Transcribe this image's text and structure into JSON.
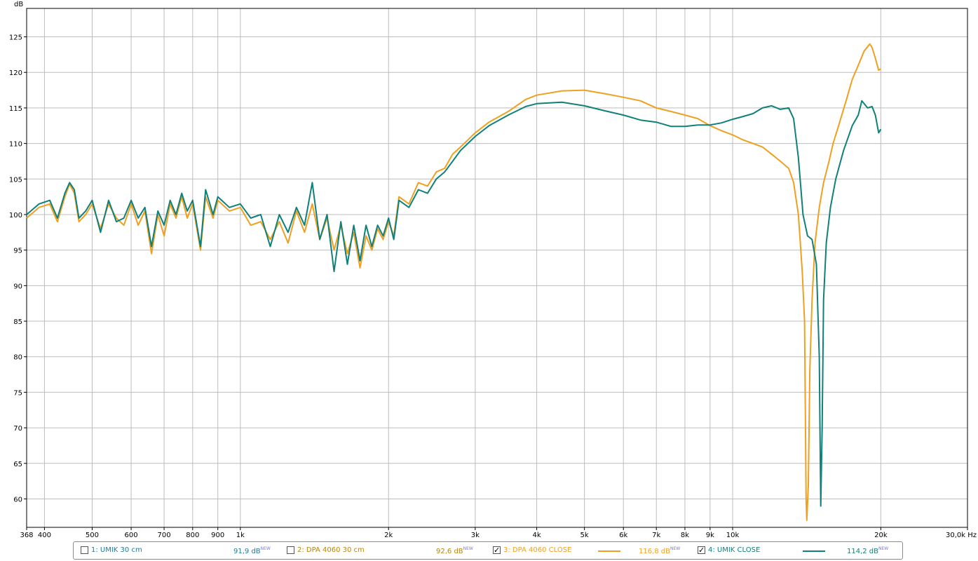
{
  "colors": {
    "grid": "#bdbdbd",
    "axis": "#000000",
    "series3": "#f0a020",
    "series4": "#10807a",
    "series1_text": "#1f7a9a",
    "series2_text": "#b8860b"
  },
  "legend": {
    "entries": [
      {
        "label": "1: UMIK 30 cm",
        "value": "91,9 dB",
        "badge": "NEW",
        "checked": false,
        "checkmark": ""
      },
      {
        "label": "2: DPA 4060 30 cm",
        "value": "92,6 dB",
        "badge": "NEW",
        "checked": false,
        "checkmark": ""
      },
      {
        "label": "3: DPA 4060  CLOSE",
        "value": "116,8 dB",
        "badge": "NEW",
        "checked": true,
        "checkmark": "✓"
      },
      {
        "label": "4: UMIK CLOSE",
        "value": "114,2 dB",
        "badge": "NEW",
        "checked": true,
        "checkmark": "✓"
      }
    ]
  },
  "chart_data": {
    "type": "line",
    "ylabel": "dB",
    "xunit": "Hz",
    "xscale": "log",
    "xlim": [
      368,
      30000
    ],
    "ylim": [
      56,
      129
    ],
    "grid": true,
    "legend_position": "bottom",
    "x_ticks": [
      {
        "v": 368,
        "t": "368"
      },
      {
        "v": 400,
        "t": "400"
      },
      {
        "v": 500,
        "t": "500"
      },
      {
        "v": 600,
        "t": "600"
      },
      {
        "v": 700,
        "t": "700"
      },
      {
        "v": 800,
        "t": "800"
      },
      {
        "v": 900,
        "t": "900"
      },
      {
        "v": 1000,
        "t": "1k"
      },
      {
        "v": 2000,
        "t": "2k"
      },
      {
        "v": 3000,
        "t": "3k"
      },
      {
        "v": 4000,
        "t": "4k"
      },
      {
        "v": 5000,
        "t": "5k"
      },
      {
        "v": 6000,
        "t": "6k"
      },
      {
        "v": 7000,
        "t": "7k"
      },
      {
        "v": 8000,
        "t": "8k"
      },
      {
        "v": 9000,
        "t": "9k"
      },
      {
        "v": 10000,
        "t": "10k"
      },
      {
        "v": 20000,
        "t": "20k"
      },
      {
        "v": 30000,
        "t": "30,0k Hz"
      }
    ],
    "y_ticks": [
      60,
      65,
      70,
      75,
      80,
      85,
      90,
      95,
      100,
      105,
      110,
      115,
      120,
      125
    ],
    "series": [
      {
        "name": "3: DPA 4060  CLOSE",
        "points": [
          [
            368,
            99.5
          ],
          [
            390,
            101.0
          ],
          [
            410,
            101.5
          ],
          [
            425,
            99.0
          ],
          [
            440,
            102.5
          ],
          [
            450,
            104.3
          ],
          [
            460,
            103.0
          ],
          [
            470,
            99.0
          ],
          [
            485,
            100.0
          ],
          [
            500,
            101.5
          ],
          [
            520,
            98.0
          ],
          [
            540,
            101.5
          ],
          [
            560,
            99.5
          ],
          [
            580,
            98.5
          ],
          [
            600,
            101.5
          ],
          [
            620,
            98.5
          ],
          [
            640,
            100.5
          ],
          [
            660,
            94.5
          ],
          [
            680,
            100.0
          ],
          [
            700,
            97.0
          ],
          [
            720,
            101.5
          ],
          [
            740,
            99.5
          ],
          [
            760,
            102.5
          ],
          [
            780,
            99.5
          ],
          [
            800,
            101.5
          ],
          [
            830,
            95.0
          ],
          [
            850,
            102.5
          ],
          [
            880,
            99.5
          ],
          [
            900,
            102.0
          ],
          [
            950,
            100.5
          ],
          [
            1000,
            101.0
          ],
          [
            1050,
            98.5
          ],
          [
            1100,
            99.0
          ],
          [
            1150,
            96.5
          ],
          [
            1200,
            99.0
          ],
          [
            1250,
            96.0
          ],
          [
            1300,
            100.5
          ],
          [
            1350,
            97.5
          ],
          [
            1400,
            101.5
          ],
          [
            1450,
            96.5
          ],
          [
            1500,
            99.5
          ],
          [
            1550,
            95.0
          ],
          [
            1600,
            98.5
          ],
          [
            1650,
            94.5
          ],
          [
            1700,
            97.5
          ],
          [
            1750,
            92.5
          ],
          [
            1800,
            97.0
          ],
          [
            1850,
            95.0
          ],
          [
            1900,
            98.0
          ],
          [
            1950,
            96.5
          ],
          [
            2000,
            99.0
          ],
          [
            2050,
            97.0
          ],
          [
            2100,
            102.5
          ],
          [
            2200,
            101.5
          ],
          [
            2300,
            104.5
          ],
          [
            2400,
            104.0
          ],
          [
            2500,
            106.0
          ],
          [
            2600,
            106.5
          ],
          [
            2700,
            108.5
          ],
          [
            2800,
            109.5
          ],
          [
            3000,
            111.5
          ],
          [
            3200,
            113.0
          ],
          [
            3500,
            114.5
          ],
          [
            3800,
            116.2
          ],
          [
            4000,
            116.8
          ],
          [
            4500,
            117.4
          ],
          [
            5000,
            117.5
          ],
          [
            5500,
            117.0
          ],
          [
            6000,
            116.5
          ],
          [
            6500,
            116.0
          ],
          [
            7000,
            115.0
          ],
          [
            7500,
            114.5
          ],
          [
            8000,
            114.0
          ],
          [
            8500,
            113.5
          ],
          [
            9000,
            112.5
          ],
          [
            9500,
            111.8
          ],
          [
            10000,
            111.2
          ],
          [
            10500,
            110.5
          ],
          [
            11000,
            110.0
          ],
          [
            11500,
            109.5
          ],
          [
            12000,
            108.5
          ],
          [
            12500,
            107.5
          ],
          [
            13000,
            106.5
          ],
          [
            13300,
            104.5
          ],
          [
            13600,
            100.0
          ],
          [
            13850,
            92.0
          ],
          [
            14000,
            85.0
          ],
          [
            14100,
            60.0
          ],
          [
            14150,
            57.0
          ],
          [
            14250,
            62.0
          ],
          [
            14350,
            78.0
          ],
          [
            14500,
            88.0
          ],
          [
            14700,
            96.0
          ],
          [
            15000,
            101.0
          ],
          [
            15300,
            104.5
          ],
          [
            15700,
            107.5
          ],
          [
            16000,
            110.0
          ],
          [
            16500,
            113.0
          ],
          [
            17000,
            116.0
          ],
          [
            17500,
            119.0
          ],
          [
            18000,
            121.0
          ],
          [
            18500,
            123.0
          ],
          [
            19000,
            124.0
          ],
          [
            19200,
            123.5
          ],
          [
            19500,
            122.0
          ],
          [
            19800,
            120.3
          ],
          [
            20000,
            120.5
          ]
        ]
      },
      {
        "name": "4: UMIK CLOSE",
        "points": [
          [
            368,
            100.0
          ],
          [
            390,
            101.5
          ],
          [
            410,
            102.0
          ],
          [
            425,
            99.5
          ],
          [
            440,
            103.0
          ],
          [
            450,
            104.5
          ],
          [
            460,
            103.5
          ],
          [
            470,
            99.5
          ],
          [
            485,
            100.5
          ],
          [
            500,
            102.0
          ],
          [
            520,
            97.5
          ],
          [
            540,
            102.0
          ],
          [
            560,
            99.0
          ],
          [
            580,
            99.5
          ],
          [
            600,
            102.0
          ],
          [
            620,
            99.5
          ],
          [
            640,
            101.0
          ],
          [
            660,
            95.5
          ],
          [
            680,
            100.5
          ],
          [
            700,
            98.5
          ],
          [
            720,
            102.0
          ],
          [
            740,
            100.0
          ],
          [
            760,
            103.0
          ],
          [
            780,
            100.5
          ],
          [
            800,
            102.0
          ],
          [
            830,
            95.5
          ],
          [
            850,
            103.5
          ],
          [
            880,
            100.0
          ],
          [
            900,
            102.5
          ],
          [
            950,
            101.0
          ],
          [
            1000,
            101.5
          ],
          [
            1050,
            99.5
          ],
          [
            1100,
            100.0
          ],
          [
            1150,
            95.5
          ],
          [
            1200,
            100.0
          ],
          [
            1250,
            97.5
          ],
          [
            1300,
            101.0
          ],
          [
            1350,
            98.5
          ],
          [
            1400,
            104.5
          ],
          [
            1450,
            96.5
          ],
          [
            1500,
            100.0
          ],
          [
            1550,
            92.0
          ],
          [
            1600,
            99.0
          ],
          [
            1650,
            93.0
          ],
          [
            1700,
            98.5
          ],
          [
            1750,
            93.5
          ],
          [
            1800,
            98.5
          ],
          [
            1850,
            95.5
          ],
          [
            1900,
            98.5
          ],
          [
            1950,
            97.0
          ],
          [
            2000,
            99.5
          ],
          [
            2050,
            96.5
          ],
          [
            2100,
            102.0
          ],
          [
            2200,
            101.0
          ],
          [
            2300,
            103.5
          ],
          [
            2400,
            103.0
          ],
          [
            2500,
            105.0
          ],
          [
            2600,
            106.0
          ],
          [
            2700,
            107.5
          ],
          [
            2800,
            109.0
          ],
          [
            3000,
            111.0
          ],
          [
            3200,
            112.5
          ],
          [
            3500,
            114.0
          ],
          [
            3800,
            115.2
          ],
          [
            4000,
            115.6
          ],
          [
            4500,
            115.8
          ],
          [
            5000,
            115.3
          ],
          [
            5500,
            114.6
          ],
          [
            6000,
            114.0
          ],
          [
            6500,
            113.3
          ],
          [
            7000,
            113.0
          ],
          [
            7500,
            112.4
          ],
          [
            8000,
            112.4
          ],
          [
            8500,
            112.6
          ],
          [
            9000,
            112.6
          ],
          [
            9500,
            112.9
          ],
          [
            10000,
            113.4
          ],
          [
            10500,
            113.8
          ],
          [
            11000,
            114.2
          ],
          [
            11500,
            115.0
          ],
          [
            12000,
            115.3
          ],
          [
            12500,
            114.8
          ],
          [
            13000,
            115.0
          ],
          [
            13300,
            113.5
          ],
          [
            13600,
            108.0
          ],
          [
            13900,
            100.0
          ],
          [
            14200,
            97.0
          ],
          [
            14500,
            96.5
          ],
          [
            14800,
            93.0
          ],
          [
            15000,
            80.0
          ],
          [
            15100,
            59.0
          ],
          [
            15200,
            70.0
          ],
          [
            15300,
            88.0
          ],
          [
            15500,
            96.0
          ],
          [
            15800,
            101.0
          ],
          [
            16200,
            105.0
          ],
          [
            16800,
            109.0
          ],
          [
            17500,
            112.5
          ],
          [
            18000,
            114.0
          ],
          [
            18300,
            116.0
          ],
          [
            18800,
            115.0
          ],
          [
            19200,
            115.2
          ],
          [
            19500,
            114.0
          ],
          [
            19800,
            111.5
          ],
          [
            20000,
            112.0
          ]
        ]
      }
    ]
  }
}
